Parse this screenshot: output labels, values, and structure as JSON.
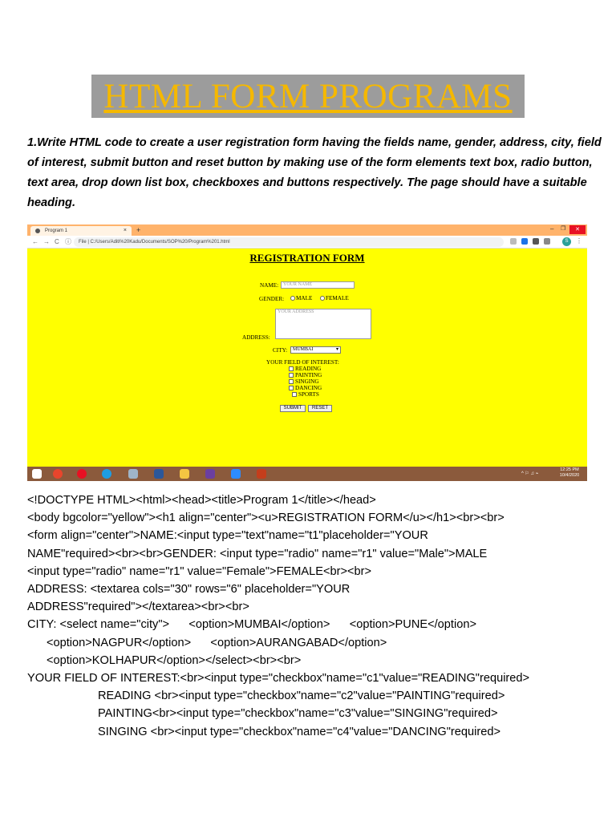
{
  "banner": {
    "title": "HTML FORM  PROGRAMS"
  },
  "question": "1.Write HTML code to create a user registration form having the fields name, gender, address, city, field of interest, submit button and reset button by making use of the form elements text box, radio button, text area, drop down list box, checkboxes and buttons respectively. The page should have a suitable heading.",
  "browser": {
    "tab_title": "Program 1",
    "tab_close": "×",
    "new_tab": "+",
    "window_controls": {
      "minimize": "–",
      "maximize": "❐",
      "close": "✕"
    },
    "nav": {
      "back": "←",
      "forward": "→",
      "reload": "C",
      "info": "ⓘ"
    },
    "url": "File  |  C:/Users/Aditi%20Kadu/Documents/SOP%20/Program%201.html",
    "profile_initial": "S",
    "menu": "⋮"
  },
  "form": {
    "heading": "REGISTRATION FORM",
    "name_label": "NAME:",
    "name_placeholder": "YOUR NAME",
    "gender_label": "GENDER:",
    "male": "MALE",
    "female": "FEMALE",
    "address_label": "ADDRESS:",
    "address_placeholder": "YOUR ADDRESS",
    "city_label": "CITY:",
    "city_selected": "MUMBAI",
    "interest_label": "YOUR FIELD OF INTEREST:",
    "interests": [
      "READING",
      "PAINTING",
      "SINGING",
      "DANCING",
      "SPORTS"
    ],
    "submit": "SUBMIT",
    "reset": "RESET"
  },
  "taskbar": {
    "clock_time": "12:25 PM",
    "clock_date": "10/4/2020",
    "tray": "^  ⚐  ♫  ⌁"
  },
  "colors": {
    "banner_bg": "#9c9c9c",
    "banner_text": "#f5b800",
    "form_bg": "#ffff00",
    "tab_strip": "#ffb36b",
    "taskbar": "#8b5a3c"
  },
  "code_lines": [
    "<!DOCTYPE HTML><html><head><title>Program 1</title></head>",
    "<body bgcolor=\"yellow\"><h1 align=\"center\"><u>REGISTRATION FORM</u></h1><br><br>",
    "<form align=\"center\">NAME:<input type=\"text\"name=\"t1\"placeholder=\"YOUR",
    "NAME\"required><br><br>GENDER: <input type=\"radio\" name=\"r1\" value=\"Male\">MALE",
    "<input type=\"radio\" name=\"r1\" value=\"Female\">FEMALE<br><br>",
    "ADDRESS: <textarea cols=\"30\" rows=\"6\" placeholder=\"YOUR",
    "ADDRESS\"required\"></textarea><br><br>",
    "CITY: <select name=\"city\">      <option>MUMBAI</option>      <option>PUNE</option>",
    "<option>NAGPUR</option>      <option>AURANGABAD</option>",
    "<option>KOLHAPUR</option></select><br><br>",
    "YOUR FIELD OF INTEREST:<br><input type=\"checkbox\"name=\"c1\"value=\"READING\"required>",
    "READING <br><input type=\"checkbox\"name=\"c2\"value=\"PAINTING\"required>",
    "PAINTING<br><input type=\"checkbox\"name=\"c3\"value=\"SINGING\"required>",
    "SINGING <br><input type=\"checkbox\"name=\"c4\"value=\"DANCING\"required>"
  ]
}
